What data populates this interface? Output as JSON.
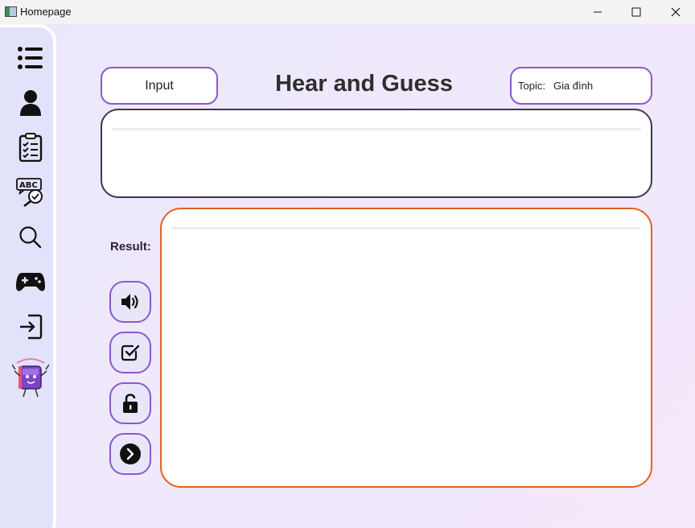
{
  "window": {
    "title": "Homepage"
  },
  "sidebar": {
    "items": [
      {
        "name": "menu",
        "icon": "list-icon"
      },
      {
        "name": "profile",
        "icon": "user-icon"
      },
      {
        "name": "tasks",
        "icon": "clipboard-icon"
      },
      {
        "name": "spelling",
        "icon": "abc-check-icon"
      },
      {
        "name": "search",
        "icon": "search-icon"
      },
      {
        "name": "game",
        "icon": "gamepad-icon",
        "active": true
      },
      {
        "name": "logout",
        "icon": "exit-icon"
      },
      {
        "name": "mascot",
        "icon": "mascot-icon"
      }
    ]
  },
  "header": {
    "input_label": "Input",
    "title": "Hear and Guess",
    "topic_label": "Topic:",
    "topic_value": "Gia đình"
  },
  "question": {
    "text": ""
  },
  "result": {
    "label": "Result:",
    "text": ""
  },
  "actions": [
    {
      "name": "play-audio",
      "icon": "speaker-icon"
    },
    {
      "name": "check-answer",
      "icon": "check-square-icon"
    },
    {
      "name": "reveal-answer",
      "icon": "unlock-icon"
    },
    {
      "name": "next-question",
      "icon": "next-circle-icon"
    }
  ],
  "colors": {
    "accent": "#8b58cf",
    "result_border": "#e4621e",
    "question_border": "#3d3656",
    "background": "#ece8fb",
    "sidebar": "#e3e2fb"
  }
}
